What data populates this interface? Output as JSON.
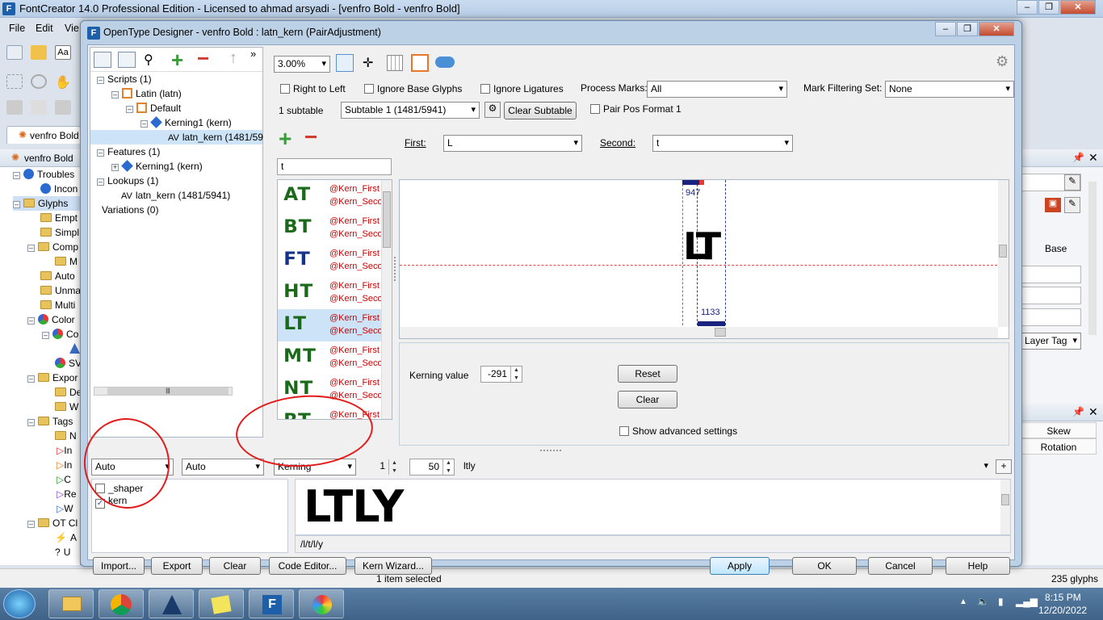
{
  "app": {
    "title": "FontCreator 14.0 Professional Edition - Licensed to ahmad arsyadi - [venfro Bold - venfro Bold]",
    "icon_letter": "F",
    "doc_tab": "venfro Bold",
    "panel_title": "venfro Bold",
    "status_selected": "1 item selected",
    "status_glyphs": "235 glyphs"
  },
  "menu": {
    "file": "File",
    "edit": "Edit",
    "view": "Vie"
  },
  "left_tree": [
    {
      "label": "Troubles"
    },
    {
      "label": "Incon"
    },
    {
      "label": "Glyphs"
    },
    {
      "label": "Empt"
    },
    {
      "label": "Simpl"
    },
    {
      "label": "Comp"
    },
    {
      "label": "M"
    },
    {
      "label": "Auto"
    },
    {
      "label": "Unma"
    },
    {
      "label": "Multi"
    },
    {
      "label": "Color"
    },
    {
      "label": "Co"
    },
    {
      "label": ""
    },
    {
      "label": "SV"
    },
    {
      "label": "Expor"
    },
    {
      "label": "De"
    },
    {
      "label": "W"
    },
    {
      "label": "Tags"
    },
    {
      "label": "N"
    },
    {
      "label": "In"
    },
    {
      "label": "In"
    },
    {
      "label": "C"
    },
    {
      "label": "Re"
    },
    {
      "label": "W"
    },
    {
      "label": "OT Cl"
    },
    {
      "label": "A"
    },
    {
      "label": "U"
    }
  ],
  "right_panel": {
    "base": "Base",
    "layer_tag": "Layer Tag",
    "skew": "Skew",
    "rotation": "Rotation"
  },
  "dialog": {
    "title": "OpenType Designer - venfro Bold : latn_kern (PairAdjustment)",
    "tree": [
      {
        "label": "Scripts (1)"
      },
      {
        "label": "Latin (latn)"
      },
      {
        "label": "Default"
      },
      {
        "label": "Kerning1 (kern)"
      },
      {
        "label": "latn_kern (1481/59"
      },
      {
        "label": "Features (1)"
      },
      {
        "label": "Kerning1 (kern)"
      },
      {
        "label": "Lookups (1)"
      },
      {
        "label": "latn_kern (1481/5941)"
      },
      {
        "label": "Variations (0)"
      }
    ],
    "zoom": "3.00%",
    "options": {
      "right_to_left": "Right to Left",
      "ignore_base": "Ignore Base Glyphs",
      "ignore_lig": "Ignore Ligatures",
      "process_marks_label": "Process Marks:",
      "process_marks_value": "All",
      "mark_filter_label": "Mark Filtering Set:",
      "mark_filter_value": "None",
      "subtable_count": "1 subtable",
      "subtable_value": "Subtable 1 (1481/5941)",
      "clear_subtable": "Clear Subtable",
      "pair_pos": "Pair Pos Format 1"
    },
    "pair": {
      "first_label": "First:",
      "first_value": "L",
      "second_label": "Second:",
      "second_value": "t",
      "filter": "t"
    },
    "glyph_list": [
      {
        "glyph": "AT",
        "class1": "@Kern_First",
        "class2": "@Kern_Seco",
        "color": "#1a6a1a"
      },
      {
        "glyph": "BT",
        "class1": "@Kern_First",
        "class2": "@Kern_Seco",
        "color": "#1a6a1a"
      },
      {
        "glyph": "FT",
        "class1": "@Kern_First",
        "class2": "@Kern_Seco",
        "color": "#16338a"
      },
      {
        "glyph": "HT",
        "class1": "@Kern_First",
        "class2": "@Kern_Seco",
        "color": "#1a6a1a"
      },
      {
        "glyph": "LT",
        "class1": "@Kern_First",
        "class2": "@Kern_Seco",
        "color": "#1a6a1a"
      },
      {
        "glyph": "MT",
        "class1": "@Kern_First",
        "class2": "@Kern_Seco",
        "color": "#1a6a1a"
      },
      {
        "glyph": "NT",
        "class1": "@Kern_First",
        "class2": "@Kern_Seco",
        "color": "#1a6a1a"
      },
      {
        "glyph": "RT",
        "class1": "@Kern_First",
        "class2": "",
        "color": "#1a6a1a"
      }
    ],
    "preview": {
      "glyphs": "LT",
      "top_value": "947",
      "bottom_value": "1133"
    },
    "kerning": {
      "label": "Kerning value",
      "value": "-291",
      "reset": "Reset",
      "clear": "Clear",
      "advanced": "Show advanced settings"
    },
    "bottom": {
      "script_combo": "Auto",
      "lang_combo": "Auto",
      "feature_combo": "Kerning",
      "num1": "1",
      "num2": "50",
      "text": "ltly",
      "features": [
        {
          "label": "_shaper",
          "checked": false
        },
        {
          "label": "kern",
          "checked": true
        }
      ],
      "preview_text": "LTLY",
      "glyph_path": "/l/t/l/y"
    },
    "buttons": {
      "import": "Import...",
      "export": "Export",
      "clear": "Clear",
      "code_editor": "Code Editor...",
      "kern_wizard": "Kern Wizard...",
      "apply": "Apply",
      "ok": "OK",
      "cancel": "Cancel",
      "help": "Help"
    }
  },
  "clock": {
    "time": "8:15 PM",
    "date": "12/20/2022"
  }
}
